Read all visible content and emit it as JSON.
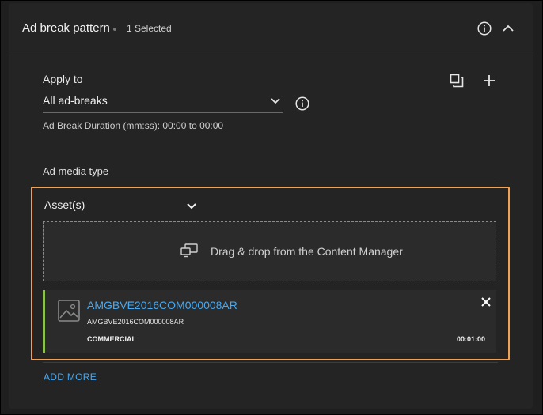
{
  "header": {
    "title": "Ad break pattern",
    "selected_count": "1 Selected",
    "info_icon": "info-icon",
    "collapse_icon": "chevron-up-icon"
  },
  "apply_to": {
    "label": "Apply to",
    "value": "All ad-breaks",
    "dropdown_icon": "chevron-down-icon",
    "info_icon": "info-icon",
    "duration_text": "Ad Break Duration (mm:ss): 00:00 to 00:00"
  },
  "toolbar": {
    "copy_icon": "copy-icon",
    "add_icon": "plus-icon"
  },
  "ad_media": {
    "label": "Ad media type",
    "type_value": "Asset(s)",
    "dropzone_text": "Drag & drop from the Content Manager",
    "dropzone_icon": "screens-icon"
  },
  "asset": {
    "title": "AMGBVE2016COM000008AR",
    "id": "AMGBVE2016COM000008AR",
    "type": "COMMERCIAL",
    "duration": "00:01:00",
    "thumbnail_icon": "image-placeholder-icon",
    "close_icon": "close-icon"
  },
  "actions": {
    "add_more": "ADD MORE"
  },
  "colors": {
    "background": "#1e1e1e",
    "panel": "#242424",
    "highlight_border": "#f0a155",
    "link": "#4aa8ee",
    "card_accent": "#8bc34a"
  }
}
